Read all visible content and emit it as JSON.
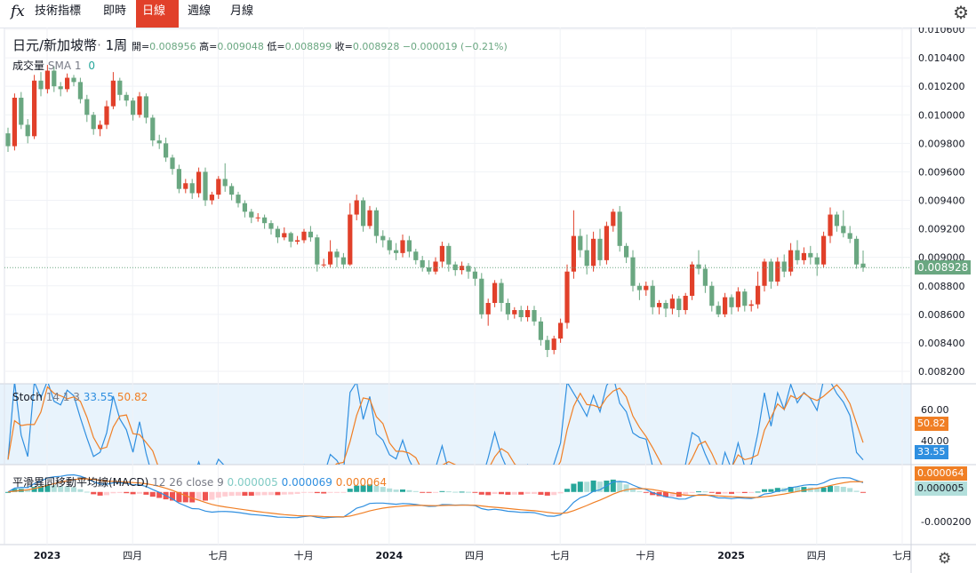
{
  "toolbar": {
    "fx_icon": "fx",
    "tabs": [
      "技術指標",
      "即時",
      "日線",
      "週線",
      "月線"
    ],
    "active_tab": "日線",
    "settings_icon": "gear-icon"
  },
  "legend": {
    "symbol": "日元/新加坡幣",
    "interval": "1周",
    "open_label": "開=",
    "open": "0.008956",
    "high_label": "高=",
    "high": "0.009048",
    "low_label": "低=",
    "low": "0.008899",
    "close_label": "收=",
    "close": "0.008928",
    "change": "−0.000019",
    "change_pct": "(−0.21%)",
    "volume_label": "成交量",
    "volume_sma": "SMA 1",
    "volume_value": "0"
  },
  "stoch_legend": {
    "name": "Stoch",
    "params": "14 1 3",
    "k": "33.55",
    "d": "50.82"
  },
  "macd_legend": {
    "name": "平滑異同移動平均線(MACD)",
    "params": "12 26 close 9",
    "hist": "0.000005",
    "macd": "0.000069",
    "signal": "0.000064"
  },
  "colors": {
    "up": "#e1402a",
    "down": "#6aa781",
    "stoch_k": "#2f8fe0",
    "stoch_d": "#f07f25",
    "macd": "#2f8fe0",
    "signal": "#f07f25"
  },
  "price_axis": {
    "labels": [
      "0.010600",
      "0.010400",
      "0.010200",
      "0.010000",
      "0.009800",
      "0.009600",
      "0.009400",
      "0.009200",
      "0.009000",
      "0.008800",
      "0.008600",
      "0.008400",
      "0.008200"
    ],
    "current": "0.008928"
  },
  "stoch_axis": {
    "labels": [
      "60.00",
      "40.00"
    ],
    "k_tag": "33.55",
    "d_tag": "50.82"
  },
  "macd_axis": {
    "labels": [
      "-0.000200"
    ],
    "signal_tag": "0.000064",
    "hist_tag": "0.000005"
  },
  "time_axis": {
    "labels": [
      "2023",
      "四月",
      "七月",
      "十月",
      "2024",
      "四月",
      "七月",
      "十月",
      "2025",
      "四月",
      "七月"
    ]
  },
  "chart_data": {
    "type": "candlestick",
    "title": "日元/新加坡幣 1周",
    "ylim": [
      0.0081,
      0.0106
    ],
    "x_label_weeks": [
      0,
      13,
      26,
      39,
      52,
      65,
      78,
      91,
      104,
      117,
      130
    ],
    "candles": [
      [
        0.00987,
        0.00978,
        0.00974,
        0.00991
      ],
      [
        0.00978,
        0.01012,
        0.00975,
        0.01015
      ],
      [
        0.01012,
        0.00993,
        0.0099,
        0.01016
      ],
      [
        0.00993,
        0.00985,
        0.0098,
        0.00997
      ],
      [
        0.00985,
        0.01024,
        0.00983,
        0.01028
      ],
      [
        0.01024,
        0.01018,
        0.01013,
        0.0103
      ],
      [
        0.01018,
        0.01031,
        0.01015,
        0.01035
      ],
      [
        0.01031,
        0.0102,
        0.01016,
        0.01034
      ],
      [
        0.0102,
        0.01018,
        0.01013,
        0.01023
      ],
      [
        0.01018,
        0.01026,
        0.01016,
        0.01029
      ],
      [
        0.01026,
        0.01023,
        0.0102,
        0.01028
      ],
      [
        0.01023,
        0.01011,
        0.01008,
        0.01026
      ],
      [
        0.01011,
        0.01,
        0.00995,
        0.01014
      ],
      [
        0.01,
        0.0099,
        0.00986,
        0.01002
      ],
      [
        0.0099,
        0.00993,
        0.00985,
        0.00996
      ],
      [
        0.00993,
        0.01006,
        0.0099,
        0.0101
      ],
      [
        0.01006,
        0.01024,
        0.01004,
        0.0103
      ],
      [
        0.01024,
        0.01014,
        0.0101,
        0.01026
      ],
      [
        0.01014,
        0.0101,
        0.01006,
        0.01016
      ],
      [
        0.0101,
        0.01,
        0.00996,
        0.01012
      ],
      [
        0.01,
        0.01013,
        0.00998,
        0.01016
      ],
      [
        0.01013,
        0.00998,
        0.00994,
        0.01015
      ],
      [
        0.00998,
        0.00982,
        0.00978,
        0.01
      ],
      [
        0.00982,
        0.0098,
        0.00976,
        0.00986
      ],
      [
        0.0098,
        0.0097,
        0.00967,
        0.00984
      ],
      [
        0.0097,
        0.00962,
        0.00958,
        0.00972
      ],
      [
        0.00962,
        0.00948,
        0.00945,
        0.00965
      ],
      [
        0.00948,
        0.00952,
        0.00945,
        0.00955
      ],
      [
        0.00952,
        0.00945,
        0.00941,
        0.00955
      ],
      [
        0.00945,
        0.0096,
        0.00942,
        0.00963
      ],
      [
        0.0096,
        0.0094,
        0.00936,
        0.00963
      ],
      [
        0.0094,
        0.00944,
        0.00937,
        0.00946
      ],
      [
        0.00944,
        0.00955,
        0.00941,
        0.00957
      ],
      [
        0.00955,
        0.0095,
        0.00946,
        0.00966
      ],
      [
        0.0095,
        0.00944,
        0.0094,
        0.00952
      ],
      [
        0.00944,
        0.00938,
        0.00935,
        0.00946
      ],
      [
        0.00938,
        0.00932,
        0.00928,
        0.0094
      ],
      [
        0.00932,
        0.00928,
        0.00924,
        0.00934
      ],
      [
        0.00928,
        0.00928,
        0.00925,
        0.00931
      ],
      [
        0.00928,
        0.00924,
        0.0092,
        0.0093
      ],
      [
        0.00924,
        0.0092,
        0.00916,
        0.00926
      ],
      [
        0.0092,
        0.00914,
        0.0091,
        0.00922
      ],
      [
        0.00914,
        0.00917,
        0.00912,
        0.00921
      ],
      [
        0.00917,
        0.00911,
        0.00907,
        0.00918
      ],
      [
        0.00911,
        0.00912,
        0.00909,
        0.00915
      ],
      [
        0.00912,
        0.00918,
        0.0091,
        0.0092
      ],
      [
        0.00918,
        0.00914,
        0.00911,
        0.00922
      ],
      [
        0.00914,
        0.00895,
        0.0089,
        0.00916
      ],
      [
        0.00895,
        0.00895,
        0.00893,
        0.00899
      ],
      [
        0.00895,
        0.00904,
        0.00893,
        0.00912
      ],
      [
        0.00904,
        0.009,
        0.00893,
        0.00906
      ],
      [
        0.009,
        0.00895,
        0.00892,
        0.00903
      ],
      [
        0.00895,
        0.0093,
        0.00894,
        0.00938
      ],
      [
        0.0093,
        0.0094,
        0.00926,
        0.00944
      ],
      [
        0.0094,
        0.00922,
        0.00918,
        0.00942
      ],
      [
        0.00922,
        0.00933,
        0.0092,
        0.00936
      ],
      [
        0.00933,
        0.00915,
        0.0091,
        0.00935
      ],
      [
        0.00915,
        0.00912,
        0.00907,
        0.00919
      ],
      [
        0.00912,
        0.00905,
        0.00902,
        0.00914
      ],
      [
        0.00905,
        0.00903,
        0.00898,
        0.0091
      ],
      [
        0.00903,
        0.00912,
        0.009,
        0.00916
      ],
      [
        0.00912,
        0.00904,
        0.009,
        0.00915
      ],
      [
        0.00904,
        0.00898,
        0.00895,
        0.00906
      ],
      [
        0.00898,
        0.00893,
        0.0089,
        0.00901
      ],
      [
        0.00893,
        0.0089,
        0.00888,
        0.00898
      ],
      [
        0.0089,
        0.00897,
        0.00888,
        0.009
      ],
      [
        0.00897,
        0.00908,
        0.00893,
        0.00911
      ],
      [
        0.00908,
        0.00895,
        0.0089,
        0.0091
      ],
      [
        0.00895,
        0.00891,
        0.00887,
        0.00897
      ],
      [
        0.00891,
        0.00894,
        0.00888,
        0.00897
      ],
      [
        0.00894,
        0.0089,
        0.00885,
        0.00896
      ],
      [
        0.0089,
        0.00885,
        0.0088,
        0.00893
      ],
      [
        0.00885,
        0.0086,
        0.00857,
        0.00889
      ],
      [
        0.0086,
        0.00868,
        0.00852,
        0.00871
      ],
      [
        0.00868,
        0.00882,
        0.00865,
        0.00884
      ],
      [
        0.00882,
        0.00868,
        0.00862,
        0.00885
      ],
      [
        0.00868,
        0.0086,
        0.00856,
        0.00871
      ],
      [
        0.0086,
        0.00863,
        0.00857,
        0.00865
      ],
      [
        0.00863,
        0.00858,
        0.00855,
        0.00866
      ],
      [
        0.00858,
        0.00863,
        0.00855,
        0.00866
      ],
      [
        0.00863,
        0.00855,
        0.00852,
        0.00866
      ],
      [
        0.00855,
        0.00842,
        0.00838,
        0.00858
      ],
      [
        0.00842,
        0.00835,
        0.0083,
        0.00845
      ],
      [
        0.00835,
        0.00843,
        0.00832,
        0.00845
      ],
      [
        0.00843,
        0.00854,
        0.0084,
        0.00857
      ],
      [
        0.00854,
        0.0089,
        0.0085,
        0.00895
      ],
      [
        0.0089,
        0.00915,
        0.00885,
        0.00933
      ],
      [
        0.00915,
        0.00905,
        0.009,
        0.0092
      ],
      [
        0.00905,
        0.00894,
        0.00888,
        0.00916
      ],
      [
        0.00894,
        0.00913,
        0.0089,
        0.00918
      ],
      [
        0.00913,
        0.00898,
        0.00894,
        0.0092
      ],
      [
        0.00898,
        0.00922,
        0.00895,
        0.00925
      ],
      [
        0.00922,
        0.00932,
        0.00918,
        0.00934
      ],
      [
        0.00932,
        0.00908,
        0.00904,
        0.00936
      ],
      [
        0.00908,
        0.009,
        0.00896,
        0.0091
      ],
      [
        0.009,
        0.0088,
        0.00876,
        0.00905
      ],
      [
        0.0088,
        0.00877,
        0.0087,
        0.00882
      ],
      [
        0.00877,
        0.0088,
        0.00873,
        0.00883
      ],
      [
        0.0088,
        0.00865,
        0.0086,
        0.00884
      ],
      [
        0.00865,
        0.00868,
        0.0086,
        0.0087
      ],
      [
        0.00868,
        0.00864,
        0.00858,
        0.0087
      ],
      [
        0.00864,
        0.00871,
        0.0086,
        0.00874
      ],
      [
        0.00871,
        0.00863,
        0.00858,
        0.00873
      ],
      [
        0.00863,
        0.00873,
        0.0086,
        0.00875
      ],
      [
        0.00873,
        0.00895,
        0.0087,
        0.00897
      ],
      [
        0.00895,
        0.00892,
        0.00888,
        0.00905
      ],
      [
        0.00892,
        0.0088,
        0.00875,
        0.00895
      ],
      [
        0.0088,
        0.00866,
        0.00862,
        0.00883
      ],
      [
        0.00866,
        0.0086,
        0.00858,
        0.00869
      ],
      [
        0.0086,
        0.00872,
        0.00858,
        0.00875
      ],
      [
        0.00872,
        0.00865,
        0.0086,
        0.00874
      ],
      [
        0.00865,
        0.00876,
        0.00862,
        0.00879
      ],
      [
        0.00876,
        0.00866,
        0.00862,
        0.00878
      ],
      [
        0.00866,
        0.00867,
        0.00862,
        0.0087
      ],
      [
        0.00867,
        0.0088,
        0.00864,
        0.0089
      ],
      [
        0.0088,
        0.00897,
        0.00876,
        0.00899
      ],
      [
        0.00897,
        0.00883,
        0.00878,
        0.00899
      ],
      [
        0.00883,
        0.00897,
        0.0088,
        0.009
      ],
      [
        0.00897,
        0.0089,
        0.00886,
        0.00902
      ],
      [
        0.0089,
        0.00905,
        0.00887,
        0.0091
      ],
      [
        0.00905,
        0.00898,
        0.00895,
        0.00912
      ],
      [
        0.00898,
        0.00903,
        0.00895,
        0.00907
      ],
      [
        0.00903,
        0.009,
        0.00895,
        0.00908
      ],
      [
        0.009,
        0.00895,
        0.00887,
        0.00903
      ],
      [
        0.00895,
        0.00915,
        0.00893,
        0.00918
      ],
      [
        0.00915,
        0.0093,
        0.0091,
        0.00935
      ],
      [
        0.0093,
        0.00922,
        0.00918,
        0.00932
      ],
      [
        0.00922,
        0.00917,
        0.00914,
        0.00933
      ],
      [
        0.00917,
        0.00913,
        0.0091,
        0.00922
      ],
      [
        0.00913,
        0.00895,
        0.00892,
        0.00915
      ],
      [
        0.008956,
        0.008928,
        0.008899,
        0.009048
      ]
    ],
    "stoch": {
      "range": [
        0,
        100
      ],
      "k_last": 33.55,
      "d_last": 50.82
    },
    "macd": {
      "range": [
        -0.00035,
        0.0001
      ],
      "hist_last": 5e-06,
      "macd_last": 6.9e-05,
      "signal_last": 6.4e-05
    }
  }
}
